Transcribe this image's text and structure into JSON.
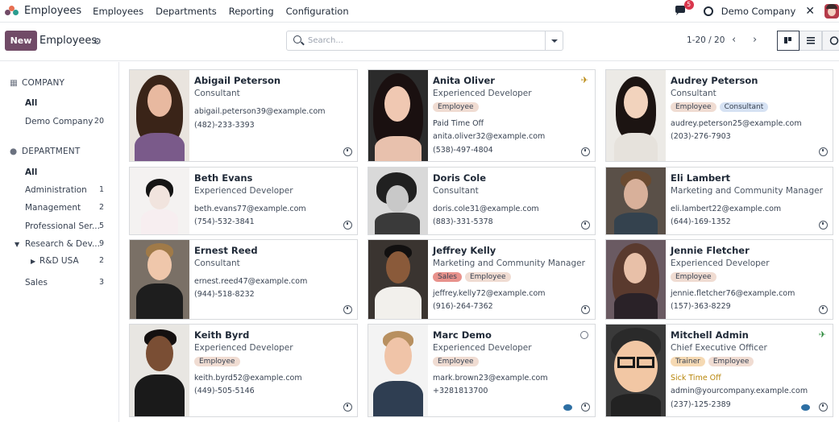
{
  "app": {
    "title": "Employees"
  },
  "nav": {
    "menu": [
      "Employees",
      "Departments",
      "Reporting",
      "Configuration"
    ]
  },
  "systray": {
    "chat_count": "5",
    "company": "Demo Company"
  },
  "control": {
    "new_label": "New",
    "breadcrumb": "Employees",
    "search_placeholder": "Search...",
    "pager": "1-20 / 20"
  },
  "sidebar": {
    "company_heading": "COMPANY",
    "company_items": [
      {
        "label": "All",
        "count": ""
      },
      {
        "label": "Demo Company",
        "count": "20"
      }
    ],
    "department_heading": "DEPARTMENT",
    "department_items": [
      {
        "label": "All",
        "count": ""
      },
      {
        "label": "Administration",
        "count": "1"
      },
      {
        "label": "Management",
        "count": "2"
      },
      {
        "label": "Professional Ser...",
        "count": "5"
      },
      {
        "label": "Research & Dev...",
        "count": "9"
      },
      {
        "label": "R&D USA",
        "count": "2"
      },
      {
        "label": "Sales",
        "count": "3"
      }
    ]
  },
  "employees": [
    {
      "name": "Abigail Peterson",
      "job": "Consultant",
      "tags": [],
      "status_text": "",
      "email": "abigail.peterson39@example.com",
      "phone": "(482)-233-3393"
    },
    {
      "name": "Anita Oliver",
      "job": "Experienced Developer",
      "tags": [
        "Employee"
      ],
      "status_text": "Paid Time Off",
      "email": "anita.oliver32@example.com",
      "phone": "(538)-497-4804"
    },
    {
      "name": "Audrey Peterson",
      "job": "Consultant",
      "tags": [
        "Employee",
        "Consultant"
      ],
      "status_text": "",
      "email": "audrey.peterson25@example.com",
      "phone": "(203)-276-7903"
    },
    {
      "name": "Beth Evans",
      "job": "Experienced Developer",
      "tags": [],
      "status_text": "",
      "email": "beth.evans77@example.com",
      "phone": "(754)-532-3841"
    },
    {
      "name": "Doris Cole",
      "job": "Consultant",
      "tags": [],
      "status_text": "",
      "email": "doris.cole31@example.com",
      "phone": "(883)-331-5378"
    },
    {
      "name": "Eli Lambert",
      "job": "Marketing and Community Manager",
      "tags": [],
      "status_text": "",
      "email": "eli.lambert22@example.com",
      "phone": "(644)-169-1352"
    },
    {
      "name": "Ernest Reed",
      "job": "Consultant",
      "tags": [],
      "status_text": "",
      "email": "ernest.reed47@example.com",
      "phone": "(944)-518-8232"
    },
    {
      "name": "Jeffrey Kelly",
      "job": "Marketing and Community Manager",
      "tags": [
        "Sales",
        "Employee"
      ],
      "status_text": "",
      "email": "jeffrey.kelly72@example.com",
      "phone": "(916)-264-7362"
    },
    {
      "name": "Jennie Fletcher",
      "job": "Experienced Developer",
      "tags": [
        "Employee"
      ],
      "status_text": "",
      "email": "jennie.fletcher76@example.com",
      "phone": "(157)-363-8229"
    },
    {
      "name": "Keith Byrd",
      "job": "Experienced Developer",
      "tags": [
        "Employee"
      ],
      "status_text": "",
      "email": "keith.byrd52@example.com",
      "phone": "(449)-505-5146"
    },
    {
      "name": "Marc Demo",
      "job": "Experienced Developer",
      "tags": [
        "Employee"
      ],
      "status_text": "",
      "email": "mark.brown23@example.com",
      "phone": "+3281813700"
    },
    {
      "name": "Mitchell Admin",
      "job": "Chief Executive Officer",
      "tags": [
        "Trainer",
        "Employee"
      ],
      "status_text": "Sick Time Off",
      "email": "admin@yourcompany.example.com",
      "phone": "(237)-125-2389"
    }
  ],
  "colors": {
    "brand": "#714b67",
    "tag_employee": "#f0dcd2",
    "tag_consultant": "#d6e2f3",
    "tag_sales": "#e8928c",
    "tag_trainer": "#f5d9b3",
    "badge": "#d9364c"
  }
}
